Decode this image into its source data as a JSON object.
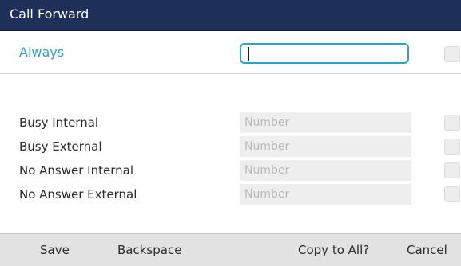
{
  "window": {
    "title": "Call Forward"
  },
  "always": {
    "label": "Always",
    "value": ""
  },
  "forward_rows": [
    {
      "label": "Busy Internal",
      "placeholder": "Number"
    },
    {
      "label": "Busy External",
      "placeholder": "Number"
    },
    {
      "label": "No Answer Internal",
      "placeholder": "Number"
    },
    {
      "label": "No Answer External",
      "placeholder": "Number"
    }
  ],
  "softkeys": {
    "save": "Save",
    "backspace": "Backspace",
    "copy_to_all": "Copy to All?",
    "cancel": "Cancel"
  },
  "colors": {
    "title_bar": "#1e2f5a",
    "accent": "#2aa3c8",
    "softkey_bar": "#e2e2e2"
  }
}
